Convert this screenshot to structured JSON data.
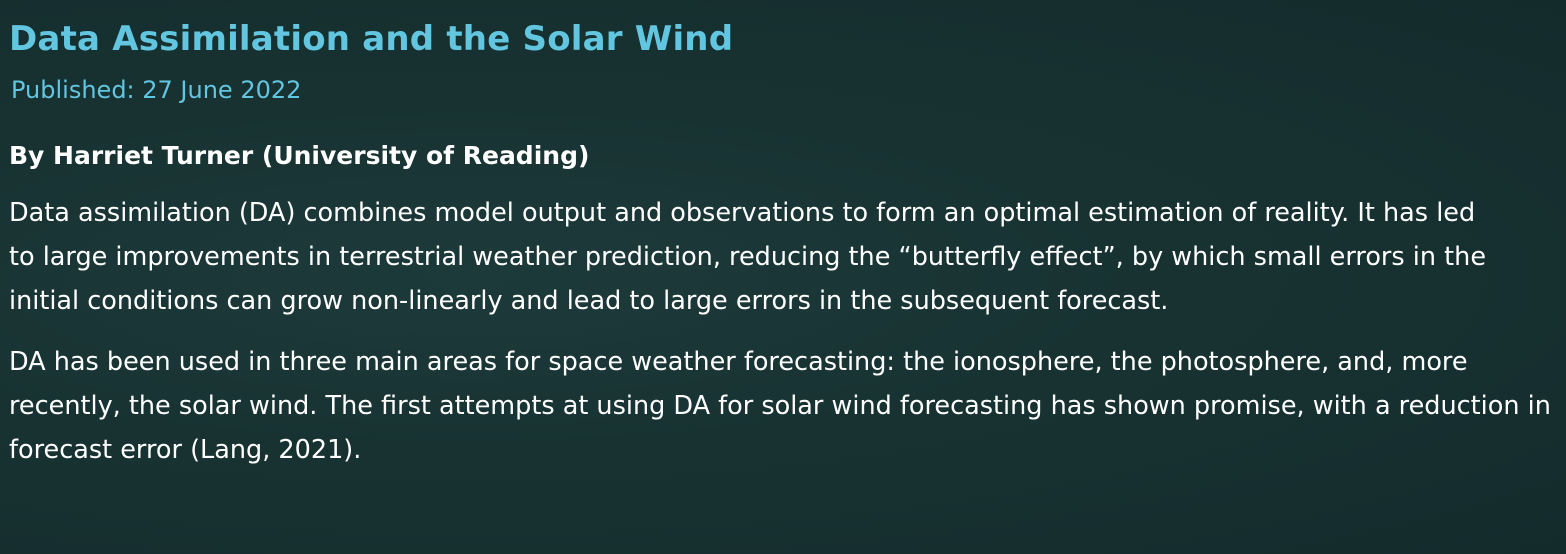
{
  "article": {
    "title": "Data Assimilation and the Solar Wind",
    "published": "Published: 27 June 2022",
    "author": "By Harriet Turner (University of Reading)",
    "paragraphs": [
      "Data assimilation (DA) combines model output and observations to form an optimal estimation of reality. It has led to large improvements in terrestrial weather prediction, reducing the “butterfly effect”, by which small errors in the initial conditions can grow non-linearly and lead to large errors in the subsequent forecast.",
      "DA has been used in three main areas for space weather forecasting: the ionosphere, the photosphere, and, more recently, the solar wind. The first attempts at using DA for solar wind forecasting has shown promise, with a reduction in forecast error (Lang, 2021)."
    ]
  },
  "colors": {
    "background": "#183232",
    "accent": "#62c6e0",
    "text": "#ffffff"
  }
}
